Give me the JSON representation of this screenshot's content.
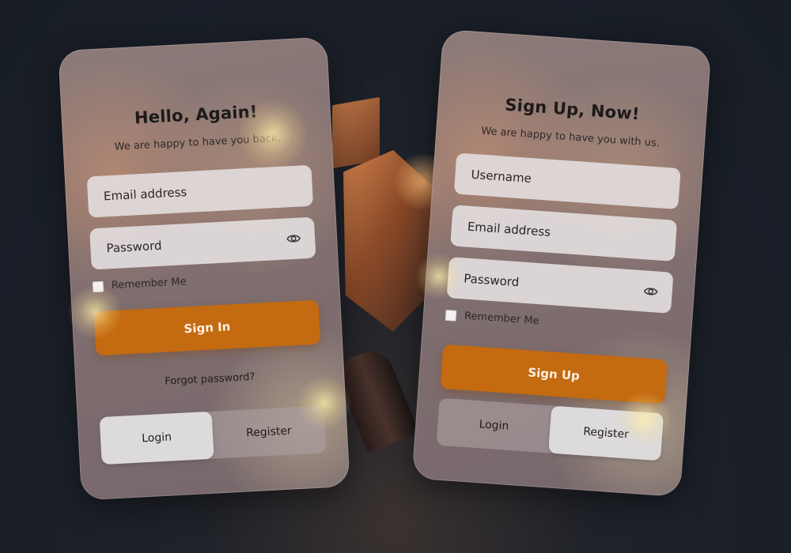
{
  "login_card": {
    "title": "Hello, Again!",
    "subtitle": "We are happy to have you back.",
    "email_placeholder": "Email address",
    "password_placeholder": "Password",
    "remember_label": "Remember Me",
    "submit_label": "Sign In",
    "forgot_label": "Forgot password?",
    "switch": {
      "login_label": "Login",
      "register_label": "Register",
      "active": "login"
    }
  },
  "signup_card": {
    "title": "Sign Up, Now!",
    "subtitle": "We are happy to have you with us.",
    "username_placeholder": "Username",
    "email_placeholder": "Email address",
    "password_placeholder": "Password",
    "remember_label": "Remember Me",
    "submit_label": "Sign Up",
    "switch": {
      "login_label": "Login",
      "register_label": "Register",
      "active": "register"
    }
  },
  "icons": {
    "password_toggle": "eye-icon"
  },
  "colors": {
    "accent": "#c46a10",
    "field_bg": "#e2dcdc",
    "active_tab": "#dcdada"
  }
}
